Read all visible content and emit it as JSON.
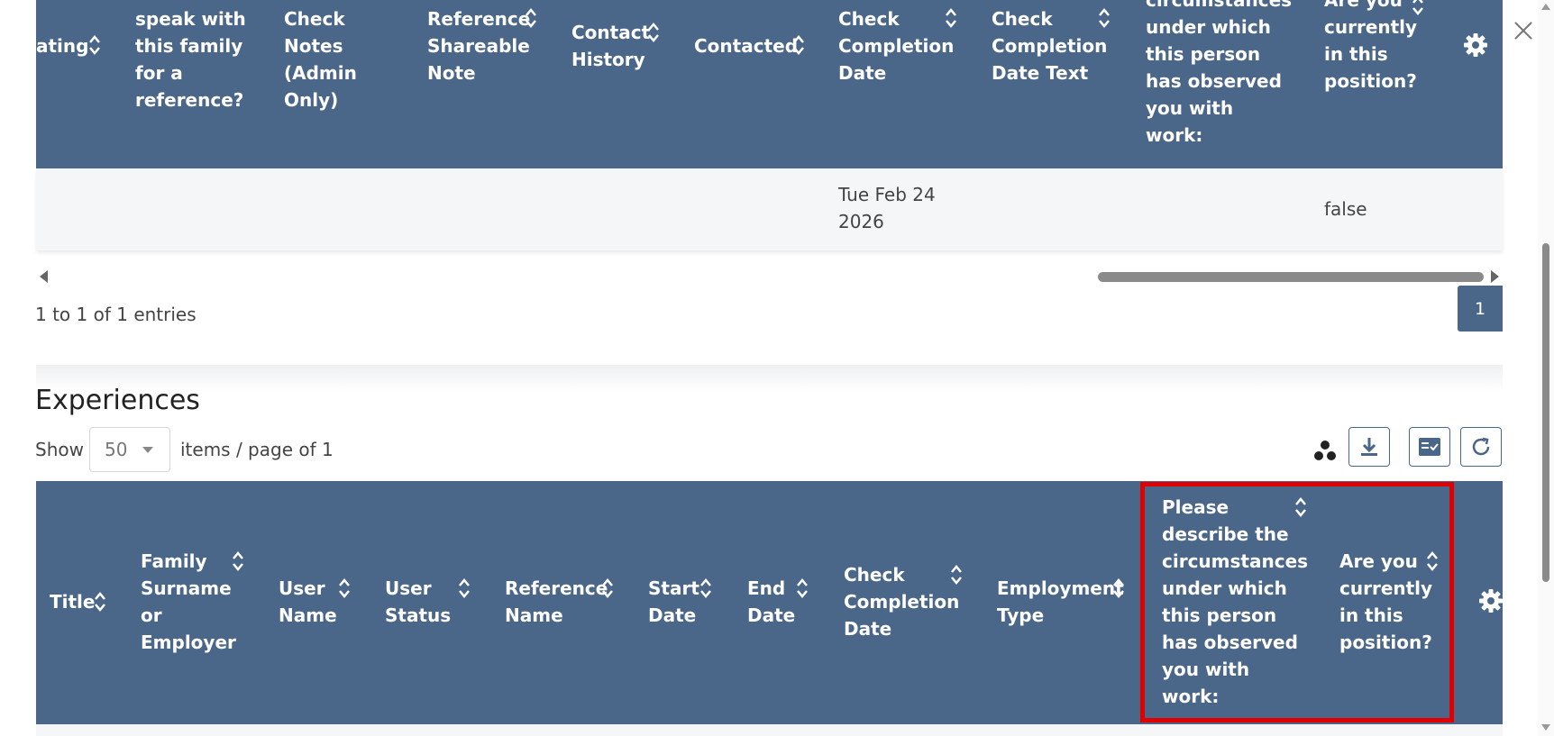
{
  "top_table": {
    "headers": {
      "rating": "ating",
      "speak": [
        "speak with",
        "this family",
        "for a",
        "reference?"
      ],
      "check_notes": [
        "Check",
        "Notes",
        "(Admin",
        "Only)"
      ],
      "shareable": [
        "Reference",
        "Shareable",
        "Note"
      ],
      "contact_history": [
        "Contact",
        "History"
      ],
      "contacted": "Contacted",
      "completion_date": [
        "Check",
        "Completion",
        "Date"
      ],
      "completion_text": [
        "Check",
        "Completion",
        "Date Text"
      ],
      "circumstances": [
        "circumstances",
        "under which",
        "this person",
        "has observed",
        "you with",
        "work:"
      ],
      "current": [
        "Are you",
        "currently",
        "in this",
        "position?"
      ]
    },
    "row": {
      "completion_date": [
        "Tue Feb 24",
        "2026"
      ],
      "current": "false"
    },
    "info": "1 to 1 of 1 entries",
    "page": "1"
  },
  "experiences": {
    "title": "Experiences",
    "show_label": "Show",
    "page_size": "50",
    "page_suffix": "items / page of 1",
    "headers": {
      "title": "Title",
      "family": [
        "Family",
        "Surname",
        "or",
        "Employer"
      ],
      "user_name": [
        "User",
        "Name"
      ],
      "user_status": [
        "User",
        "Status"
      ],
      "reference_name": [
        "Reference",
        "Name"
      ],
      "start_date": [
        "Start",
        "Date"
      ],
      "end_date": [
        "End",
        "Date"
      ],
      "completion_date": [
        "Check",
        "Completion",
        "Date"
      ],
      "employment": [
        "Employment",
        "Type"
      ],
      "describe": [
        "Please",
        "describe the",
        "circumstances",
        "under which",
        "this person",
        "has observed",
        "you with",
        "work:"
      ],
      "current": [
        "Are you",
        "currently",
        "in this",
        "position?"
      ]
    }
  },
  "icons": {
    "close": "close-icon",
    "gear": "gear-icon",
    "download": "download-icon",
    "columns": "column-chooser-icon",
    "refresh": "refresh-icon",
    "grouping": "grouping-icon"
  },
  "colors": {
    "header_bg": "#4a6789",
    "highlight": "#e00000"
  }
}
